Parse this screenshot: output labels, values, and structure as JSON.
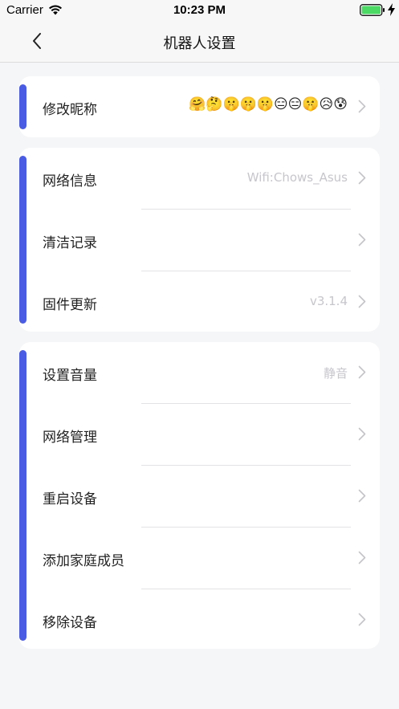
{
  "status_bar": {
    "carrier": "Carrier",
    "time": "10:23 PM"
  },
  "nav": {
    "title": "机器人设置"
  },
  "card1": {
    "nickname": {
      "label": "修改昵称",
      "emoji": "🤗🤔🤫🤫🤫😑😑🤫😥😰"
    }
  },
  "card2": {
    "network_info": {
      "label": "网络信息",
      "value": "Wifi:Chows_Asus"
    },
    "clean_records": {
      "label": "清洁记录"
    },
    "firmware": {
      "label": "固件更新",
      "value": "v3.1.4"
    }
  },
  "card3": {
    "volume": {
      "label": "设置音量",
      "value": "静音"
    },
    "network_manage": {
      "label": "网络管理"
    },
    "restart": {
      "label": "重启设备"
    },
    "add_family": {
      "label": "添加家庭成员"
    },
    "remove_device": {
      "label": "移除设备"
    }
  },
  "colors": {
    "accent": "#4a5ce3",
    "battery": "#4cd964",
    "background": "#f5f6f8"
  }
}
